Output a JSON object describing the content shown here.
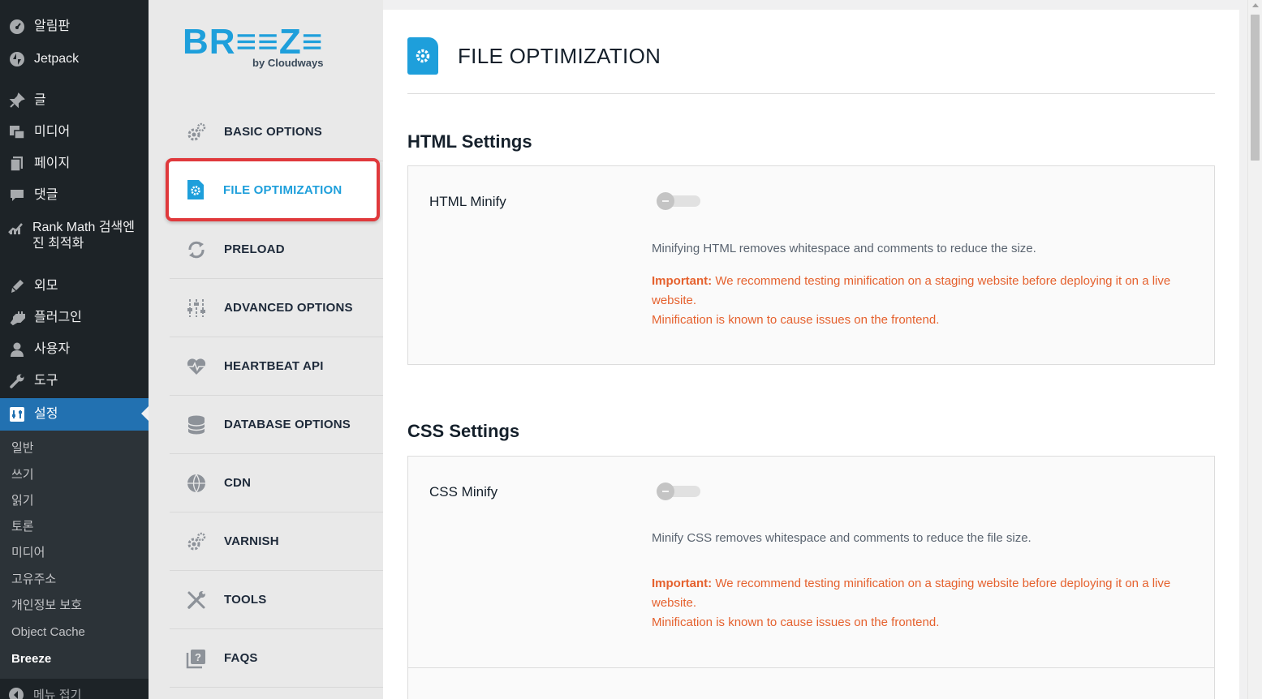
{
  "wp_menu": {
    "items": [
      {
        "label": "알림판",
        "icon": "dashboard-icon"
      },
      {
        "label": "Jetpack",
        "icon": "jetpack-icon"
      },
      {
        "label": "글",
        "icon": "pin-icon"
      },
      {
        "label": "미디어",
        "icon": "media-icon"
      },
      {
        "label": "페이지",
        "icon": "pages-icon"
      },
      {
        "label": "댓글",
        "icon": "comments-icon"
      },
      {
        "label": "Rank Math 검색엔진 최적화",
        "icon": "rankmath-icon"
      },
      {
        "label": "외모",
        "icon": "appearance-icon"
      },
      {
        "label": "플러그인",
        "icon": "plugins-icon"
      },
      {
        "label": "사용자",
        "icon": "users-icon"
      },
      {
        "label": "도구",
        "icon": "tools-icon"
      },
      {
        "label": "설정",
        "icon": "settings-icon"
      }
    ],
    "submenu": [
      "일반",
      "쓰기",
      "읽기",
      "토론",
      "미디어",
      "고유주소",
      "개인정보 보호",
      "Object Cache",
      "Breeze"
    ],
    "collapse_label": "메뉴 접기"
  },
  "logo": {
    "word": "BR≡≡Z≡",
    "by": "by Cloudways"
  },
  "breeze_nav": [
    {
      "label": "BASIC OPTIONS",
      "icon": "gears-icon"
    },
    {
      "label": "FILE OPTIMIZATION",
      "icon": "file-gear-icon"
    },
    {
      "label": "PRELOAD",
      "icon": "refresh-icon"
    },
    {
      "label": "ADVANCED OPTIONS",
      "icon": "sliders-icon"
    },
    {
      "label": "HEARTBEAT API",
      "icon": "heartbeat-icon"
    },
    {
      "label": "DATABASE OPTIONS",
      "icon": "database-icon"
    },
    {
      "label": "CDN",
      "icon": "globe-icon"
    },
    {
      "label": "VARNISH",
      "icon": "gears-icon"
    },
    {
      "label": "TOOLS",
      "icon": "tools-icon"
    },
    {
      "label": "FAQS",
      "icon": "faq-icon"
    }
  ],
  "main": {
    "title": "FILE OPTIMIZATION",
    "html_section": {
      "title": "HTML Settings",
      "option_label": "HTML Minify",
      "enabled": false,
      "description": "Minifying HTML removes whitespace and comments to reduce the size.",
      "important_prefix": "Important:",
      "important_text": " We recommend testing minification on a staging website before deploying it on a live website.",
      "issue_text": "Minification is known to cause issues on the frontend."
    },
    "css_section": {
      "title": "CSS Settings",
      "option_label": "CSS Minify",
      "enabled": false,
      "description": "Minify CSS removes whitespace and comments to reduce the file size.",
      "important_prefix": "Important:",
      "important_text": " We recommend testing minification on a staging website before deploying it on a live website.",
      "issue_text": "Minification is known to cause issues on the frontend."
    }
  },
  "colors": {
    "wp_sidebar": "#1d2327",
    "wp_active": "#2271b1",
    "breeze_blue": "#1e9fdb",
    "highlight_red": "#e0393c",
    "warning_orange": "#e5612e"
  }
}
